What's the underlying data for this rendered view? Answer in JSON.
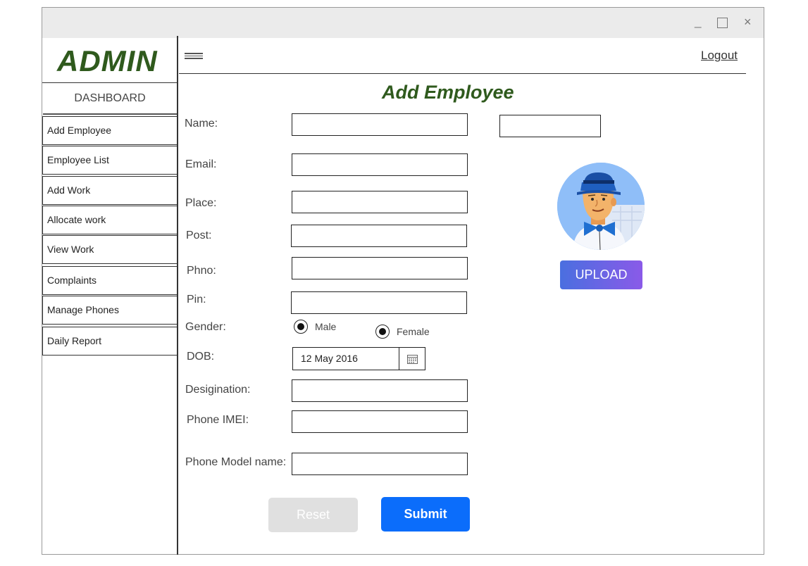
{
  "window": {
    "controls": {
      "minimize": "_",
      "maximize": "",
      "close": "×"
    }
  },
  "sidebar": {
    "logo": "ADMIN",
    "dashboard": "DASHBOARD",
    "items": [
      {
        "label": "Add Employee"
      },
      {
        "label": "Employee List"
      },
      {
        "label": "Add Work"
      },
      {
        "label": "Allocate work"
      },
      {
        "label": "View Work"
      },
      {
        "label": "Complaints"
      },
      {
        "label": "Manage Phones"
      },
      {
        "label": "Daily Report"
      }
    ]
  },
  "header": {
    "logout": "Logout"
  },
  "form": {
    "title": "Add Employee",
    "labels": {
      "name": "Name:",
      "email": "Email:",
      "place": "Place:",
      "post": "Post:",
      "phno": "Phno:",
      "pin": "Pin:",
      "gender": "Gender:",
      "dob": "DOB:",
      "designation": "Desigination:",
      "imei": "Phone IMEI:",
      "model": "Phone Model name:"
    },
    "gender_options": {
      "male": "Male",
      "female": "Female"
    },
    "dob_value": "12 May 2016",
    "reset": "Reset",
    "submit": "Submit"
  },
  "photo": {
    "upload": "UPLOAD"
  },
  "colors": {
    "accent_green": "#2f5a1d",
    "submit_blue": "#0b6dfb"
  },
  "icons": [
    "hamburger-icon",
    "calendar-icon",
    "minimize-icon",
    "maximize-icon",
    "close-icon"
  ]
}
